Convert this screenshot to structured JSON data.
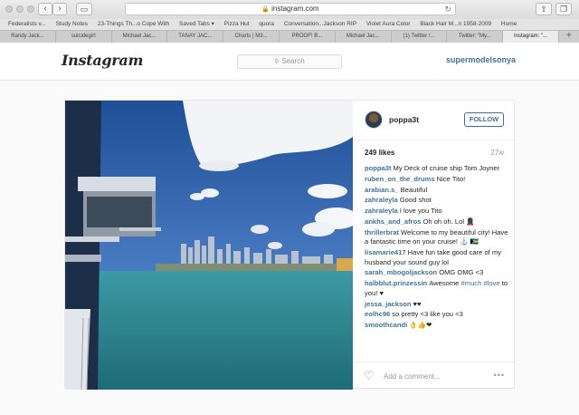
{
  "browser": {
    "url": "instagram.com",
    "bookmarks": [
      "Federalists v...",
      "Study Notes",
      "23-Things Th...o Cope With",
      "Saved Tabs ▾",
      "Pizza Hut",
      "quora",
      "Conversation...Jackson RIP",
      "Violet Aura Color",
      "Black Hair M...n 1958-2009",
      "Home"
    ],
    "tabs": [
      "Randy Jack...",
      "suicidegirl",
      "Michael Jac...",
      "TANAY JAC...",
      "Charts | M3...",
      "PROOF! B...",
      "Michael Jac...",
      "(1) Twitter /...",
      "Twitter: \"My...",
      "Instagram: \"..."
    ],
    "active_tab": 9
  },
  "header": {
    "logo": "Instagram",
    "search_placeholder": "Search",
    "username": "supermodelsonya"
  },
  "post": {
    "poster": "poppa3t",
    "follow_label": "FOLLOW",
    "likes": "249 likes",
    "age": "27w",
    "comments": [
      {
        "user": "poppa3t",
        "text": "My Deck of cruise ship Tom Joyner"
      },
      {
        "user": "ruben_on_the_drums",
        "text": "Nice Tito!"
      },
      {
        "user": "arabian.s_",
        "text": "Beautiful"
      },
      {
        "user": "zahraleyla",
        "text": "Good shot"
      },
      {
        "user": "zahraleyla",
        "text": "I love you Tito"
      },
      {
        "user": "ankhs_and_afros",
        "text": "Oh oh oh. Lol 💂🏿"
      },
      {
        "user": "thrillerbrat",
        "text": "Welcome to my beautiful city! Have a fantastic time on your cruise! ⚓️ 🇧🇸"
      },
      {
        "user": "lisamarie417",
        "text": "Have fun take good care of my husband your sound guy lol"
      },
      {
        "user": "sarah_mbogoljackson",
        "text": "OMG OMG <3"
      },
      {
        "user": "halbblut.prinzessin",
        "text": "Awesome ",
        "tag1": "#much",
        "tag2": "#love",
        "after": " to you! ♥"
      },
      {
        "user": "jessa_jackson",
        "text": "♥♥"
      },
      {
        "user": "eolhc96",
        "text": "so pretty <3 like you <3"
      },
      {
        "user": "smoothcandi",
        "text": "👌👍❤"
      }
    ],
    "add_comment_placeholder": "Add a comment...",
    "more_label": "•••"
  }
}
